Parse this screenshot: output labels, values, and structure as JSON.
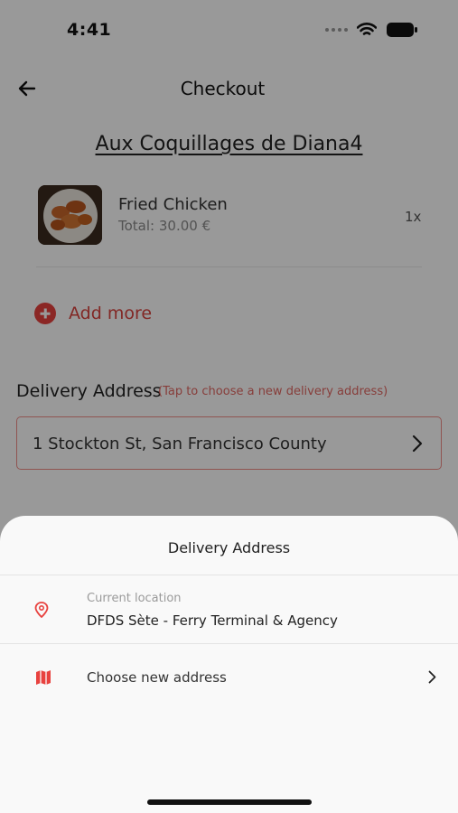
{
  "status_bar": {
    "time": "4:41"
  },
  "header": {
    "title": "Checkout"
  },
  "restaurant": {
    "name": "Aux Coquillages de Diana4"
  },
  "cart": {
    "items": [
      {
        "name": "Fried Chicken",
        "total": "Total: 30.00 €",
        "quantity": "1x"
      }
    ],
    "add_more_label": "Add more"
  },
  "delivery": {
    "title": "Delivery Address",
    "hint": "(Tap to choose a new delivery address)",
    "address": "1 Stockton St, San Francisco County"
  },
  "sheet": {
    "title": "Delivery Address",
    "current_location_caption": "Current location",
    "current_location_value": "DFDS Sète - Ferry Terminal & Agency",
    "choose_new_label": "Choose new address"
  },
  "colors": {
    "accent": "#e8423f",
    "overlay": "rgba(0,0,0,0.40)"
  },
  "icons": [
    "back-arrow-icon",
    "add-icon",
    "chevron-right-icon",
    "location-pin-icon",
    "map-icon",
    "wifi-icon",
    "battery-icon"
  ]
}
